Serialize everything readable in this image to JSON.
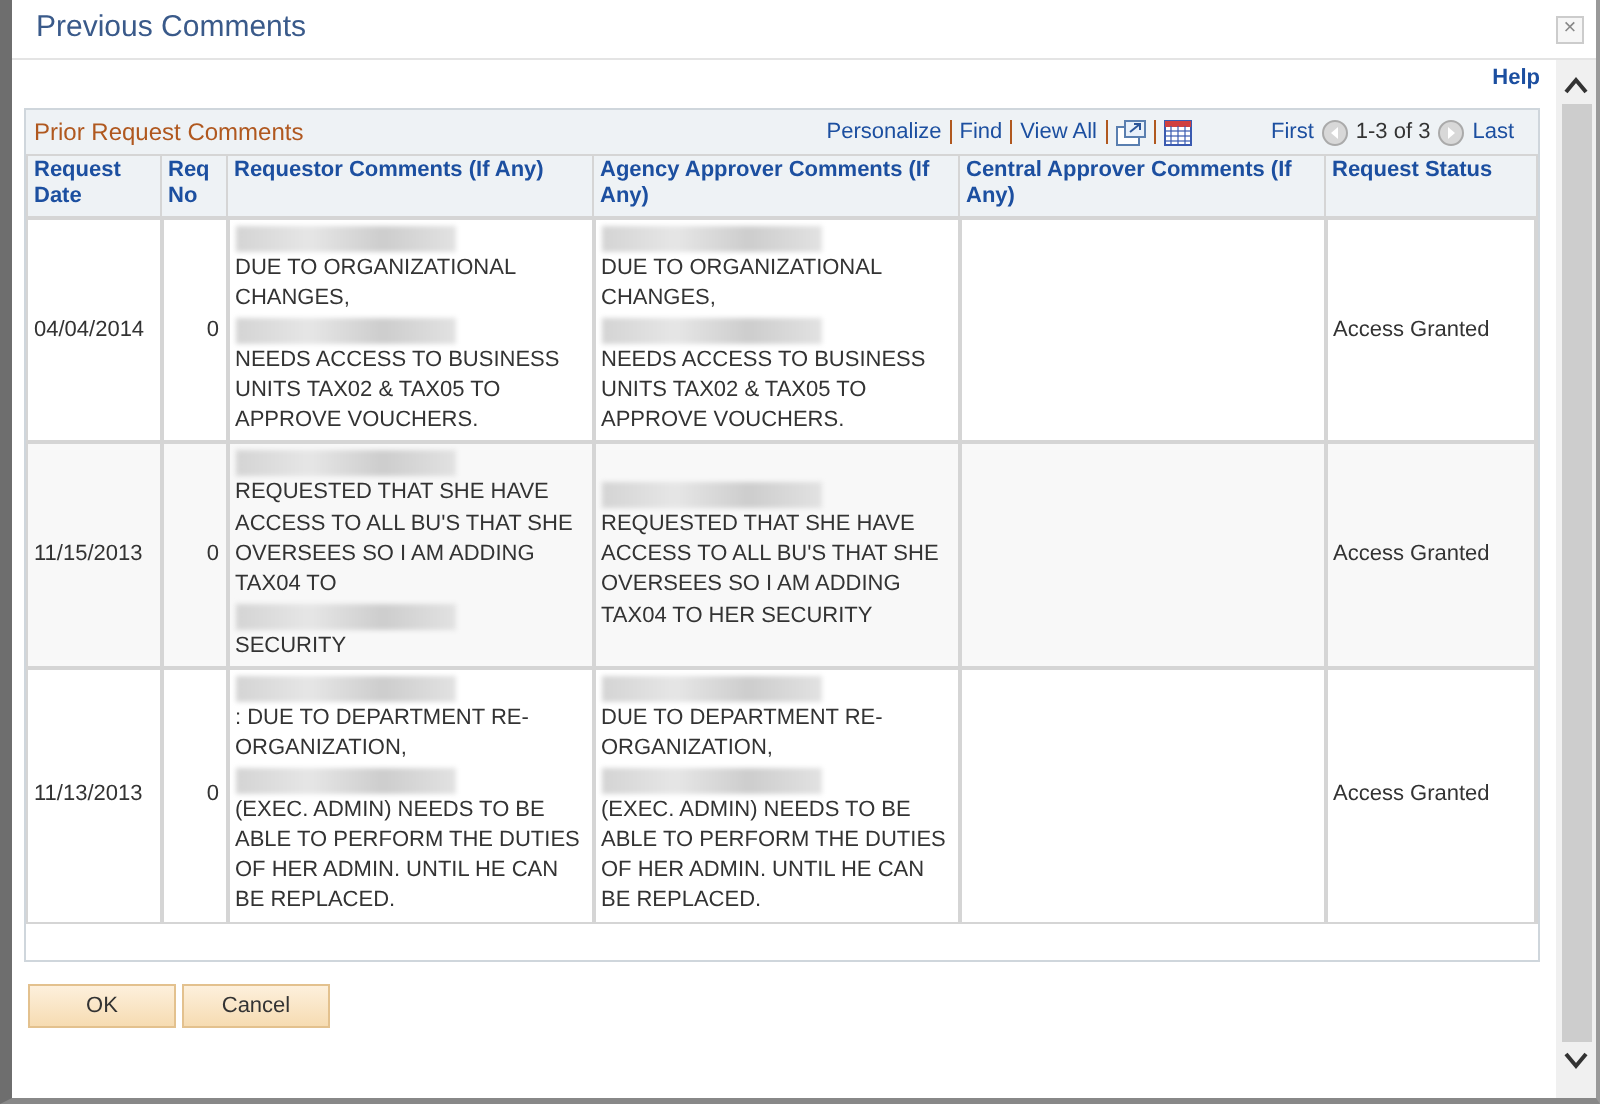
{
  "window": {
    "title": "Previous Comments",
    "close": "×"
  },
  "help": "Help",
  "grid": {
    "title": "Prior Request Comments",
    "links": [
      "Personalize",
      "Find",
      "View All"
    ],
    "nav": {
      "first": "First",
      "range": "1-3 of 3",
      "last": "Last"
    },
    "columns": [
      "Request Date",
      "Req No",
      "Requestor Comments (If Any)",
      "Agency Approver Comments (If Any)",
      "Central Approver Comments (If Any)",
      "Request Status"
    ],
    "rows": [
      {
        "date": "04/04/2014",
        "req_no": "0",
        "requestor": [
          {
            "kind": "redacted"
          },
          {
            "kind": "text",
            "text": "DUE TO ORGANIZATIONAL CHANGES,"
          },
          {
            "kind": "redacted"
          },
          {
            "kind": "text",
            "text": "NEEDS ACCESS TO BUSINESS UNITS  TAX02 & TAX05 TO APPROVE VOUCHERS."
          }
        ],
        "agency": [
          {
            "kind": "redacted"
          },
          {
            "kind": "text",
            "text": "DUE TO ORGANIZATIONAL CHANGES,"
          },
          {
            "kind": "redacted"
          },
          {
            "kind": "text",
            "text": "NEEDS ACCESS TO BUSINESS UNITS  TAX02 & TAX05 TO APPROVE VOUCHERS."
          }
        ],
        "status": "Access Granted"
      },
      {
        "date": "11/15/2013",
        "req_no": "0",
        "requestor": [
          {
            "kind": "redacted"
          },
          {
            "kind": "text",
            "text": "REQUESTED THAT SHE HAVE ACCESS TO ALL BU'S THAT SHE OVERSEES SO I AM ADDING TAX04 TO"
          },
          {
            "kind": "redacted"
          },
          {
            "kind": "text",
            "text": "SECURITY"
          }
        ],
        "agency": [
          {
            "kind": "redacted"
          },
          {
            "kind": "text",
            "text": "REQUESTED THAT SHE HAVE ACCESS TO ALL BU'S THAT SHE OVERSEES SO I AM ADDING TAX04 TO HER SECURITY"
          }
        ],
        "status": "Access Granted"
      },
      {
        "date": "11/13/2013",
        "req_no": "0",
        "requestor": [
          {
            "kind": "redacted"
          },
          {
            "kind": "text",
            "text": ": DUE TO DEPARTMENT RE-ORGANIZATION,"
          },
          {
            "kind": "redacted"
          },
          {
            "kind": "text",
            "text": "(EXEC. ADMIN) NEEDS TO BE ABLE TO PERFORM THE DUTIES OF HER ADMIN. UNTIL HE CAN BE REPLACED."
          }
        ],
        "agency": [
          {
            "kind": "redacted"
          },
          {
            "kind": "text",
            "text": "DUE TO DEPARTMENT RE-ORGANIZATION,"
          },
          {
            "kind": "redacted"
          },
          {
            "kind": "text",
            "text": "(EXEC. ADMIN) NEEDS TO BE ABLE TO PERFORM THE DUTIES OF HER ADMIN. UNTIL HE CAN BE REPLACED."
          }
        ],
        "status": "Access Granted"
      }
    ]
  },
  "buttons": [
    "OK",
    "Cancel"
  ]
}
